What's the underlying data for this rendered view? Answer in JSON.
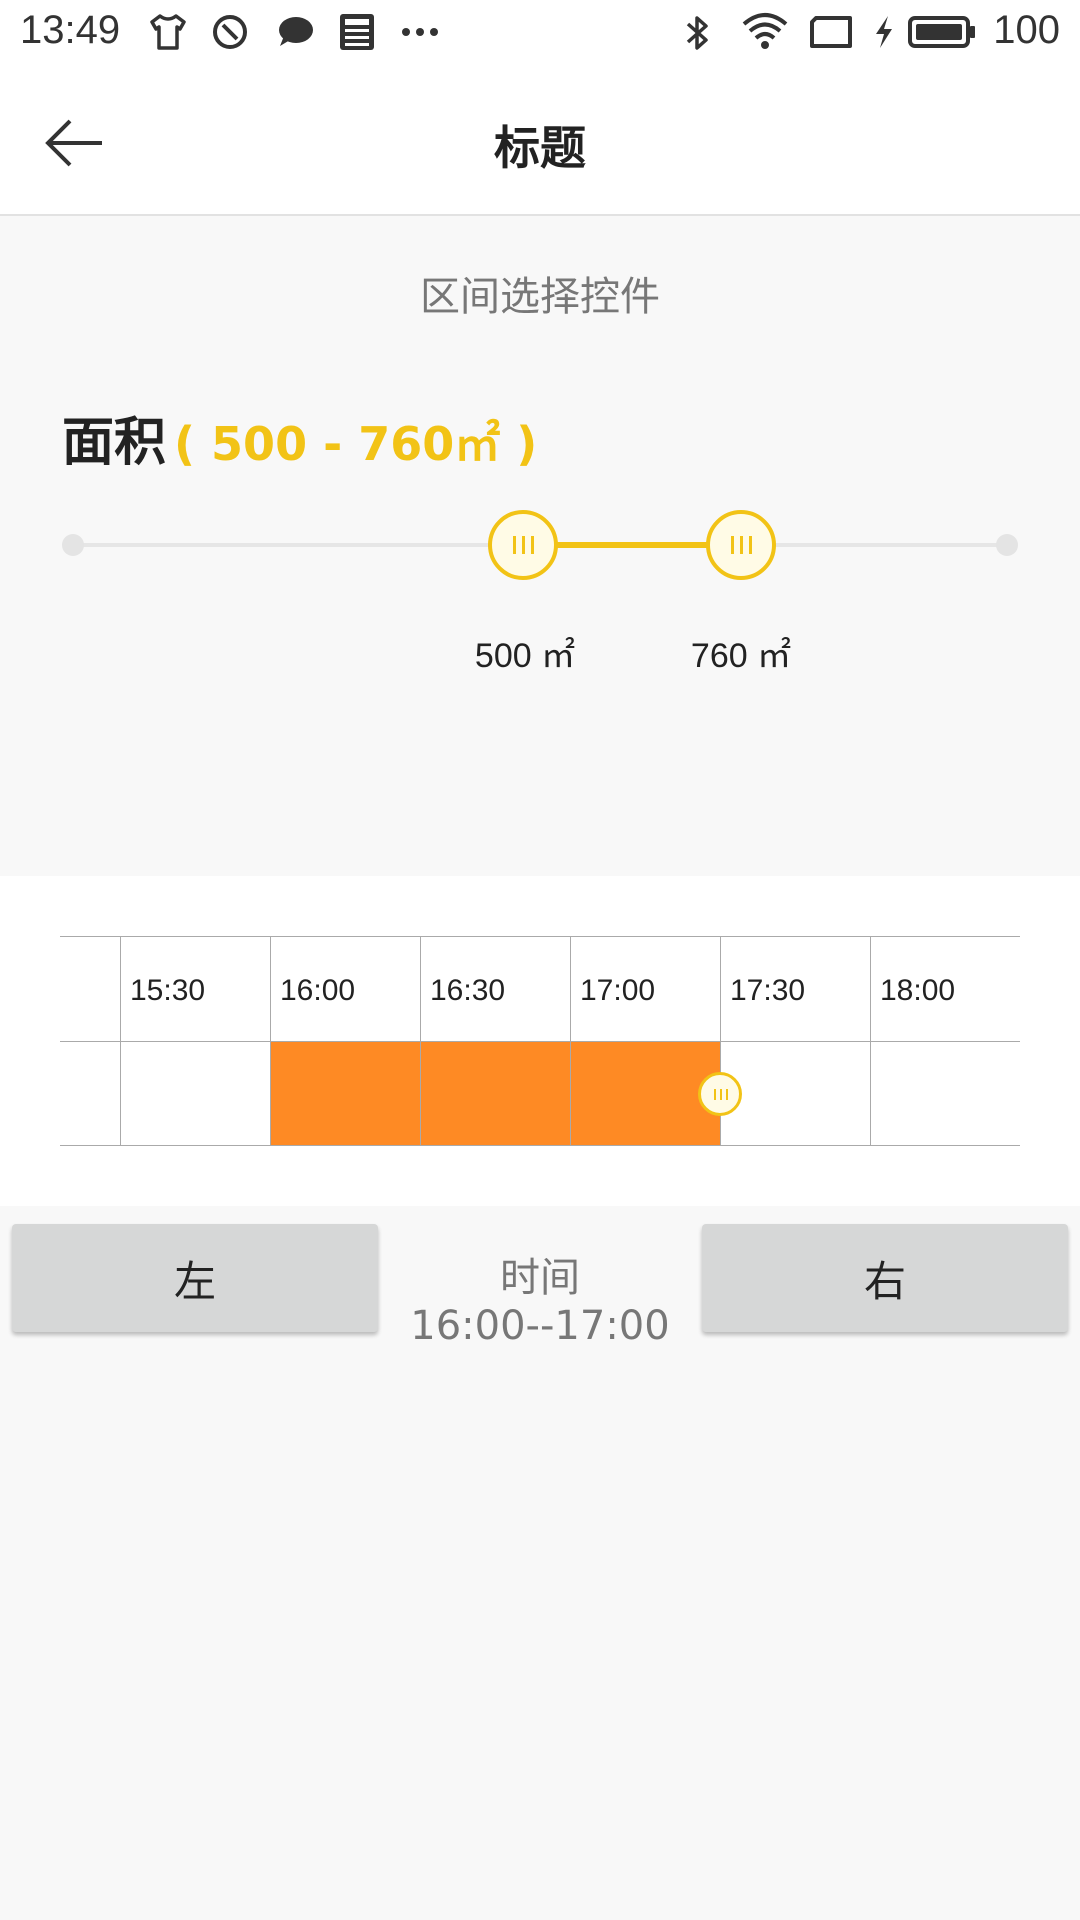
{
  "status_bar": {
    "time": "13:49",
    "left_icons": [
      "tshirt-icon",
      "blocked-icon",
      "chat-bubble-icon",
      "news-icon",
      "more-dots-icon"
    ],
    "right_icons": [
      "bluetooth-icon",
      "wifi-icon",
      "screen-icon",
      "charging-icon",
      "battery-icon"
    ],
    "battery": "100"
  },
  "app_bar": {
    "back_icon": "arrow-left-icon",
    "title": "标题"
  },
  "subtitle": "区间选择控件",
  "area": {
    "label": "面积",
    "range_text": "( 500 - 760㎡ )",
    "accent_color": "#f2c316",
    "min_value": "500 ㎡",
    "max_value": "760 ㎡"
  },
  "time_table": {
    "slots": [
      "15:30",
      "16:00",
      "16:30",
      "17:00",
      "17:30",
      "18:00"
    ],
    "selection_color": "#fe8a24"
  },
  "controls": {
    "left_label": "左",
    "right_label": "右",
    "time_title": "时间",
    "time_range": "16:00--17:00"
  }
}
